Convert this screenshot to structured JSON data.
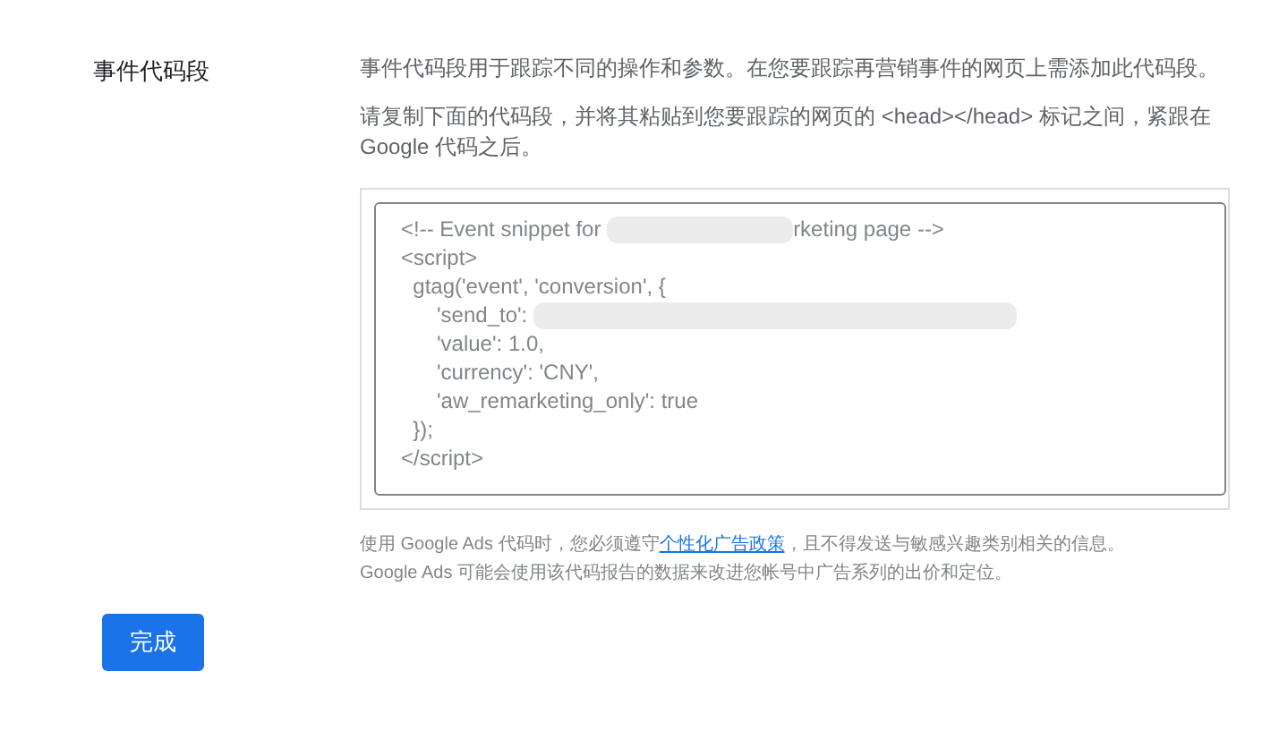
{
  "section_label": "事件代码段",
  "paragraphs": [
    "事件代码段用于跟踪不同的操作和参数。在您要跟踪再营销事件的网页上需添加此代码段。",
    "请复制下面的代码段，并将其粘贴到您要跟踪的网页的 <head></head> 标记之间，紧跟在 Google 代码之后。"
  ],
  "code_lines": [
    {
      "segments": [
        {
          "kind": "text",
          "text": "<!-- Event snippet for "
        },
        {
          "kind": "redacted"
        },
        {
          "kind": "text",
          "text": "rketing page -->"
        }
      ]
    },
    {
      "segments": [
        {
          "kind": "text",
          "text": "<script>"
        }
      ]
    },
    {
      "segments": [
        {
          "kind": "text",
          "text": "  gtag('event', 'conversion', {"
        }
      ]
    },
    {
      "segments": [
        {
          "kind": "text",
          "text": "      'send_to': "
        },
        {
          "kind": "redacted"
        }
      ]
    },
    {
      "segments": [
        {
          "kind": "text",
          "text": "      'value': 1.0,"
        }
      ]
    },
    {
      "segments": [
        {
          "kind": "text",
          "text": "      'currency': 'CNY',"
        }
      ]
    },
    {
      "segments": [
        {
          "kind": "text",
          "text": "      'aw_remarketing_only': true"
        }
      ]
    },
    {
      "segments": [
        {
          "kind": "text",
          "text": "  });"
        }
      ]
    },
    {
      "segments": [
        {
          "kind": "text",
          "text": "</script>"
        }
      ]
    }
  ],
  "footnote": {
    "before": "使用 Google Ads 代码时，您必须遵守",
    "link": "个性化广告政策",
    "after": "，且不得发送与敏感兴趣类别相关的信息。",
    "second_line": "Google Ads 可能会使用该代码报告的数据来改进您帐号中广告系列的出价和定位。"
  },
  "done_button": "完成"
}
